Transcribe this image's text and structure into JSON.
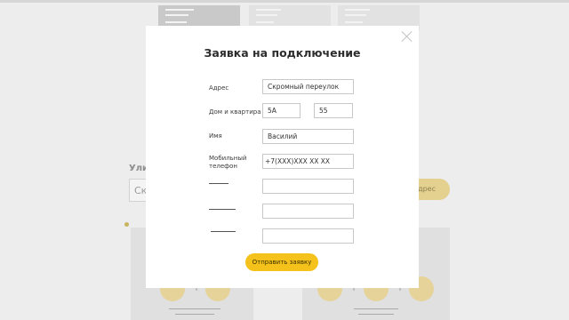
{
  "background": {
    "street_label": "Улиц",
    "street_input_value": "Ск",
    "address_button_label": "дрес"
  },
  "modal": {
    "title": "Заявка на подключение",
    "fields": {
      "address_label": "Адрес",
      "address_value": "Скромный переулок",
      "house_label": "Дом и квартира",
      "house_value": "5А",
      "apartment_value": "55",
      "name_label": "Имя",
      "name_value": "Василий",
      "phone_label_line1": "Мобильный",
      "phone_label_line2": "телефон",
      "phone_value": "+7(XXX)XXX XX XX"
    },
    "submit_label": "Отправить заявку"
  },
  "colors": {
    "accent": "#f4c21b",
    "overlay_background": "#ededed",
    "modal_background": "#ffffff"
  }
}
